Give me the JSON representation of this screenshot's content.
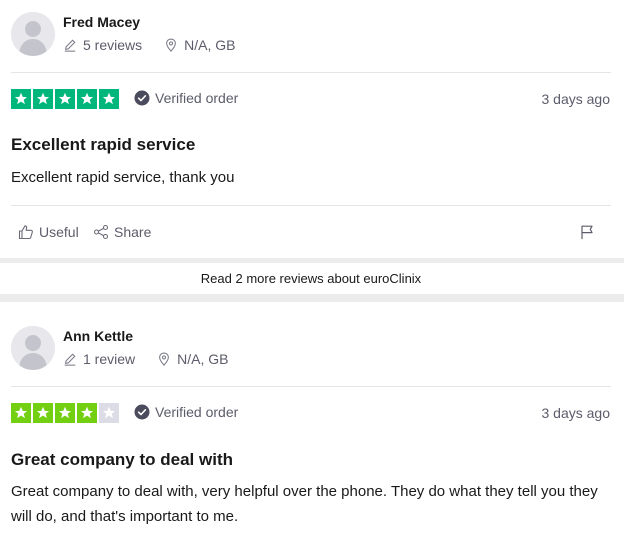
{
  "colors": {
    "star_green": "#00b67a",
    "star_light_green": "#73cf11",
    "star_empty": "#dcdce6",
    "text_primary": "#191919",
    "text_secondary": "#5c5c6b",
    "verified_badge": "#5c5c6b"
  },
  "reviews": [
    {
      "reviewer_name": "Fred Macey",
      "review_count": "5 reviews",
      "location": "N/A, GB",
      "rating": 5,
      "verified_label": "Verified order",
      "date": "3 days ago",
      "title": "Excellent rapid service",
      "text": "Excellent rapid service, thank you",
      "useful_label": "Useful",
      "share_label": "Share"
    },
    {
      "reviewer_name": "Ann Kettle",
      "review_count": "1 review",
      "location": "N/A, GB",
      "rating": 4,
      "verified_label": "Verified order",
      "date": "3 days ago",
      "title": "Great company to deal with",
      "text": "Great company to deal with, very helpful over the phone. They do what they tell you they will do, and that's important to me."
    }
  ],
  "more_reviews_link": "Read 2 more reviews about euroClinix",
  "icons": {
    "avatar": "person-silhouette-icon",
    "reviews": "pencil-icon",
    "location": "location-pin-icon",
    "verified": "check-circle-icon",
    "useful": "thumbs-up-icon",
    "share": "share-icon",
    "report": "flag-icon",
    "star": "star-icon"
  }
}
